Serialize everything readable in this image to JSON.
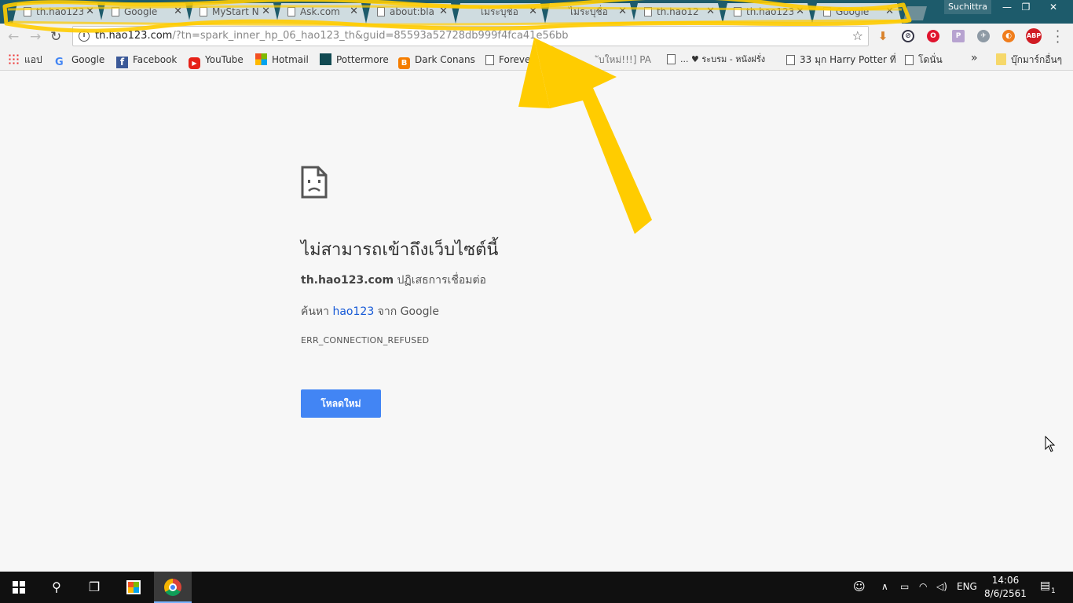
{
  "browser": {
    "profile_name": "Suchittra",
    "tabs": [
      {
        "title": "th.hao123"
      },
      {
        "title": "Google"
      },
      {
        "title": "MyStart N"
      },
      {
        "title": "Ask.com"
      },
      {
        "title": "about:bla"
      },
      {
        "title": "ไม่ระบุชื่อ"
      },
      {
        "title": "ไม่ระบุชื่อ"
      },
      {
        "title": "th.hao12"
      },
      {
        "title": "th.hao123"
      },
      {
        "title": "Google"
      }
    ],
    "url_host": "th.hao123.com",
    "url_rest": "/?tn=spark_inner_hp_06_hao123_th&guid=85593a52728db999f4fca41e56bb",
    "extensions": [
      "download-icon",
      "block-icon",
      "opera-icon",
      "pdf-icon",
      "bird-icon",
      "orange-icon",
      "adblock-icon"
    ],
    "adblock_label": "ABP"
  },
  "bookmarks": [
    {
      "label": "แอป",
      "icon": "apps-icon"
    },
    {
      "label": "Google",
      "icon": "google-icon"
    },
    {
      "label": "Facebook",
      "icon": "facebook-icon"
    },
    {
      "label": "YouTube",
      "icon": "youtube-icon"
    },
    {
      "label": "Hotmail",
      "icon": "windows-icon"
    },
    {
      "label": "Pottermore",
      "icon": "pottermore-icon"
    },
    {
      "label": "Dark Conans",
      "icon": "blogger-icon"
    },
    {
      "label": "Foreve",
      "icon": "page-icon"
    },
    {
      "label": "ับใหม่!!!] PA",
      "icon": "page-icon"
    },
    {
      "label": "... ♥ ระบรม - หนังฝรั่ง",
      "icon": "page-icon"
    },
    {
      "label": "33 มุก Harry Potter ที่",
      "icon": "page-icon"
    },
    {
      "label": "โดนั่น",
      "icon": "page-icon"
    }
  ],
  "bookmarks_overflow": "»",
  "other_bookmarks": "บุ๊กมาร์กอื่นๆ",
  "error": {
    "title": "ไม่สามารถเข้าถึงเว็บไซต์นี้",
    "host": "th.hao123.com",
    "host_suffix": " ปฏิเสธการเชื่อมต่อ",
    "search_prefix": "ค้นหา ",
    "search_link": "hao123",
    "search_suffix": " จาก Google",
    "code": "ERR_CONNECTION_REFUSED",
    "reload_label": "โหลดใหม่"
  },
  "taskbar": {
    "language": "ENG",
    "time": "14:06",
    "date": "8/6/2561",
    "notification_count": "1"
  },
  "colors": {
    "tabstrip": "#1d5b6b",
    "highlight": "#ffcc00",
    "reload_button": "#4285f4",
    "link": "#1558d6"
  }
}
